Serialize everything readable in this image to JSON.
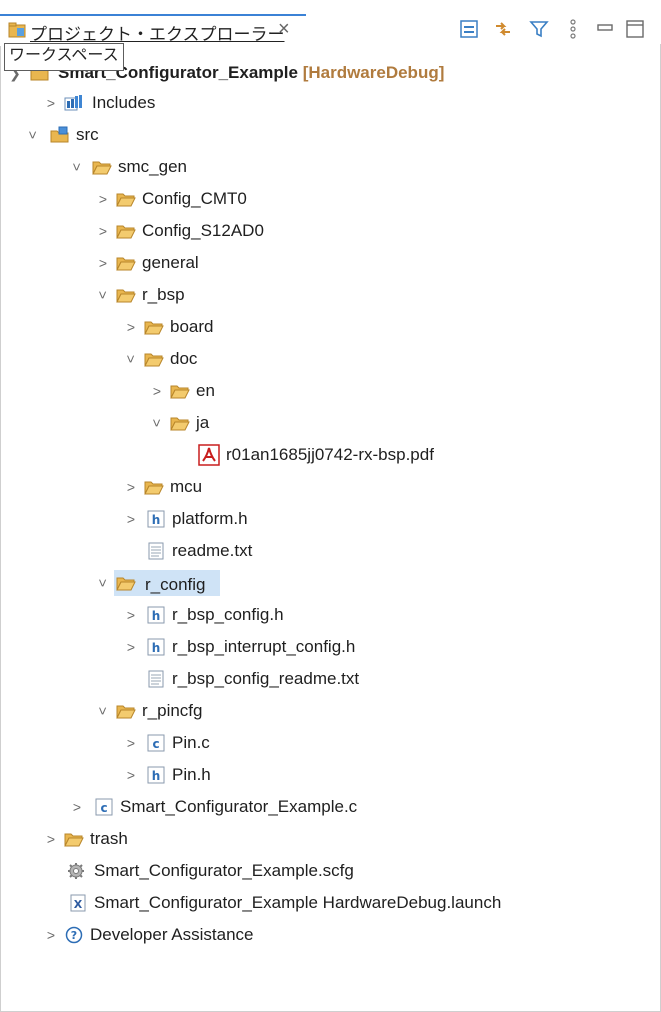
{
  "view": {
    "tab_title": "プロジェクト・エクスプローラー",
    "close_glyph": "×",
    "tooltip": "ワークスペース"
  },
  "project": {
    "name": "Smart_Configurator_Example",
    "config": "[HardwareDebug]"
  },
  "tree": {
    "includes": "Includes",
    "src": "src",
    "smc_gen": "smc_gen",
    "config_cmt0": "Config_CMT0",
    "config_s12ad0": "Config_S12AD0",
    "general": "general",
    "r_bsp": "r_bsp",
    "board": "board",
    "doc": "doc",
    "en": "en",
    "ja": "ja",
    "pdf": "r01an1685jj0742-rx-bsp.pdf",
    "mcu": "mcu",
    "platform_h": "platform.h",
    "readme_txt": "readme.txt",
    "r_config": "r_config",
    "r_bsp_config_h": "r_bsp_config.h",
    "r_bsp_interrupt_config_h": "r_bsp_interrupt_config.h",
    "r_bsp_config_readme_txt": "r_bsp_config_readme.txt",
    "r_pincfg": "r_pincfg",
    "pin_c": "Pin.c",
    "pin_h": "Pin.h",
    "main_c": "Smart_Configurator_Example.c",
    "trash": "trash",
    "scfg": "Smart_Configurator_Example.scfg",
    "launch": "Smart_Configurator_Example HardwareDebug.launch",
    "dev_assist": "Developer Assistance"
  }
}
